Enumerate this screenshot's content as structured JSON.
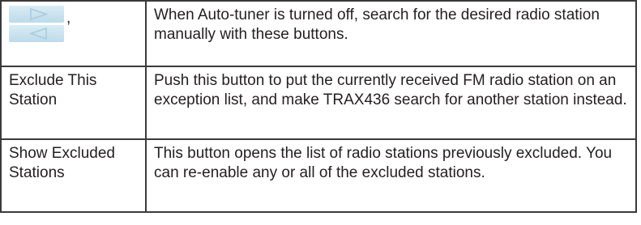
{
  "rows": [
    {
      "label": ",",
      "icons": [
        "arrow-right-icon",
        "arrow-left-icon"
      ],
      "description": "When Auto-tuner is turned off, search for the desired radio station manually with these buttons."
    },
    {
      "label": "Exclude This Station",
      "description": "Push this button to put the currently received FM radio station on an exception list, and make TRAX436 search for another station instead."
    },
    {
      "label": "Show Excluded Stations",
      "description": "This button opens the list of radio stations previously excluded. You can re-enable any or all of the excluded stations."
    }
  ],
  "colors": {
    "button_bg": "#c8e2ee",
    "arrow": "#a9cbdd",
    "border": "#3a3a3a",
    "text": "#231f20"
  }
}
